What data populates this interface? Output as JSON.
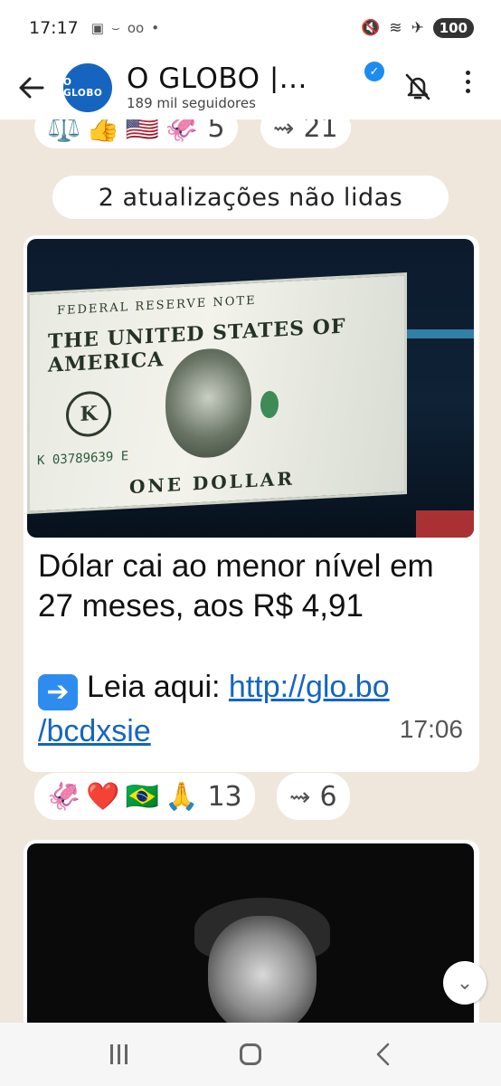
{
  "status_bar": {
    "time": "17:17",
    "battery": "100"
  },
  "header": {
    "channel_name": "O GLOBO |...",
    "followers": "189 mil seguidores",
    "logo_text": "O GLOBO"
  },
  "prev_reactions": {
    "emojis": [
      "⚖️",
      "👍",
      "🇺🇸",
      "🦑"
    ],
    "count": "5",
    "forwards": "21"
  },
  "unread_banner": "2 atualizações não lidas",
  "message": {
    "image_bill_text": {
      "header": "FEDERAL RESERVE NOTE",
      "title": "THE UNITED STATES OF AMERICA",
      "seal": "K",
      "serial": "K 03789639 E",
      "denomination": "ONE DOLLAR"
    },
    "headline": "Dólar cai ao menor nível em 27 meses, aos R$ 4,91",
    "read_label": "Leia aqui:",
    "link": "http://glo.bo/bcdxsie",
    "link_line1": "http://glo.bo",
    "link_line2": "/bcdxsie",
    "time": "17:06",
    "reactions": {
      "emojis": [
        "🦑",
        "❤️",
        "🇧🇷",
        "🙏"
      ],
      "count": "13",
      "forwards": "6"
    }
  },
  "colors": {
    "chat_bg": "#efe7dc",
    "link": "#1565c0",
    "logo_bg": "#1565c0",
    "verified": "#1d8cf0"
  }
}
